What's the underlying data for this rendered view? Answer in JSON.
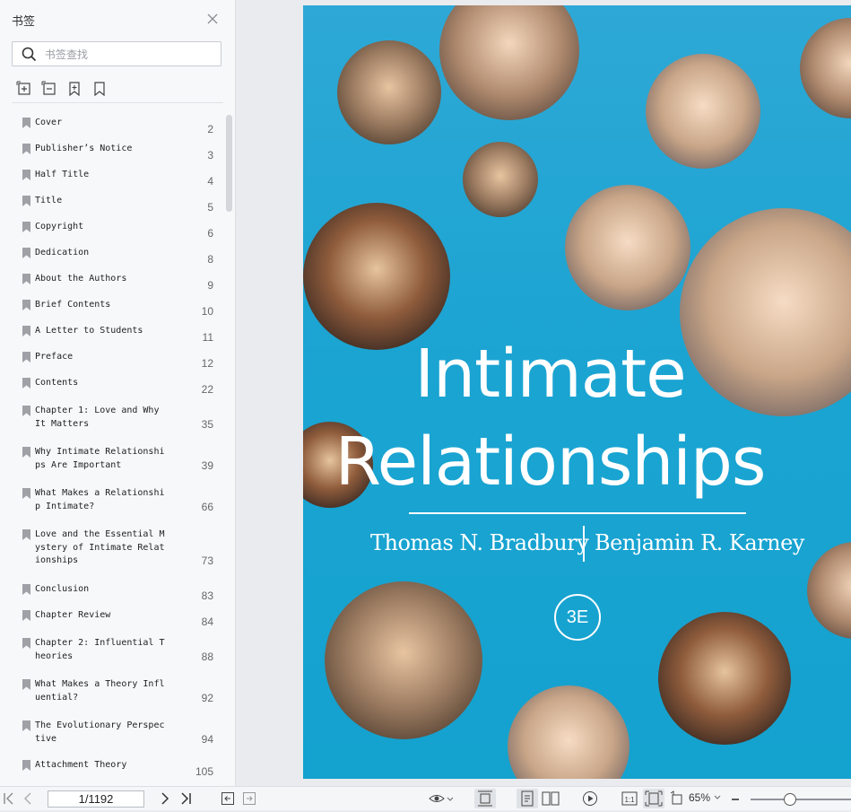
{
  "sidebar": {
    "title": "书签",
    "search_placeholder": "书签查找",
    "bookmarks": [
      {
        "label": "Cover",
        "page": "2"
      },
      {
        "label": "Publisher’s Notice",
        "page": "3"
      },
      {
        "label": "Half Title",
        "page": "4"
      },
      {
        "label": "Title",
        "page": "5"
      },
      {
        "label": "Copyright",
        "page": "6"
      },
      {
        "label": "Dedication",
        "page": "8"
      },
      {
        "label": "About the Authors",
        "page": "9"
      },
      {
        "label": "Brief Contents",
        "page": "10"
      },
      {
        "label": "A Letter to Students",
        "page": "11"
      },
      {
        "label": "Preface",
        "page": "12"
      },
      {
        "label": "Contents",
        "page": "22"
      },
      {
        "label": "Chapter 1: Love and Why It Matters",
        "page": "35"
      },
      {
        "label": "Why Intimate Relationships Are Important",
        "page": "39"
      },
      {
        "label": "What Makes a Relationship Intimate?",
        "page": "66"
      },
      {
        "label": "Love and the Essential Mystery of Intimate Relationships",
        "page": "73"
      },
      {
        "label": "Conclusion",
        "page": "83"
      },
      {
        "label": "Chapter Review",
        "page": "84"
      },
      {
        "label": "Chapter 2: Influential Theories",
        "page": "88"
      },
      {
        "label": "What Makes a Theory Influential?",
        "page": "92"
      },
      {
        "label": "The Evolutionary Perspective",
        "page": "94"
      },
      {
        "label": "Attachment Theory",
        "page": "105"
      }
    ]
  },
  "cover": {
    "title_line1": "Intimate",
    "title_line2": "Relationships",
    "author1": "Thomas N. Bradbury",
    "author2": "Benjamin R. Karney",
    "edition": "3E"
  },
  "toolbar": {
    "page_indicator": "1/1192",
    "zoom": "65%"
  },
  "colors": {
    "cover_blue": "#1ba4d2",
    "sidebar_bg": "#f7f8fa"
  }
}
